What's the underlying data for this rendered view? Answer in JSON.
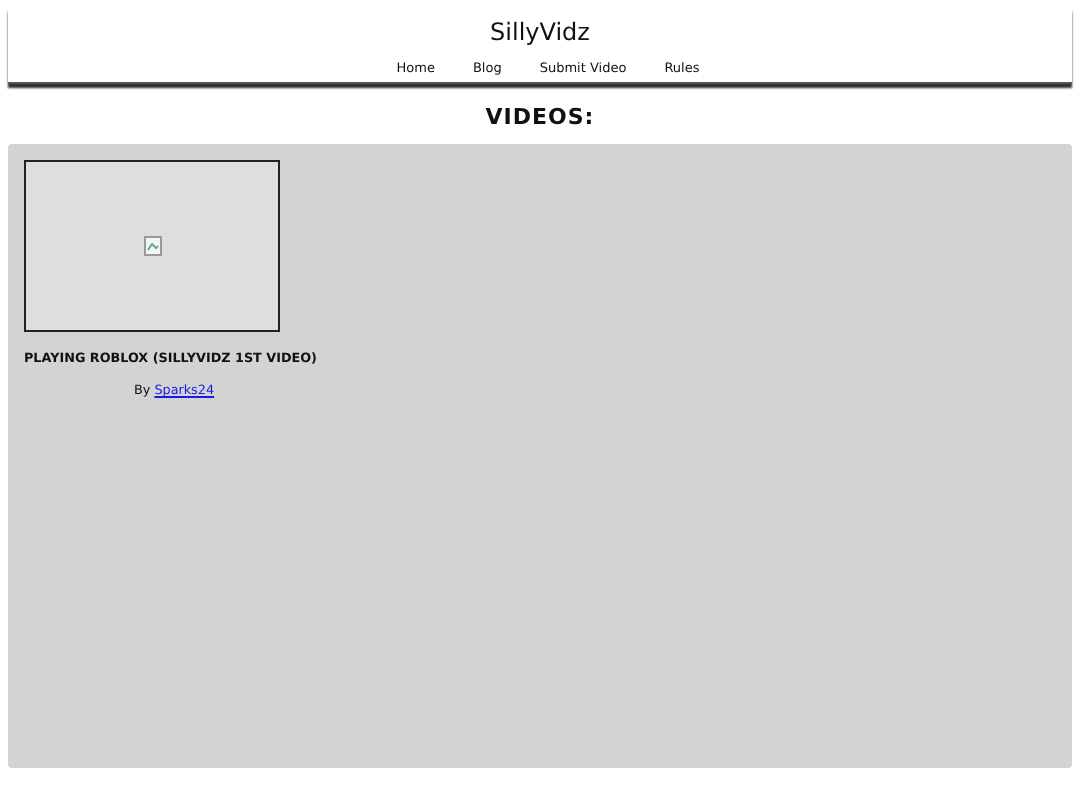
{
  "site_title": "SillyVidz",
  "nav": [
    "Home",
    "Blog",
    "Submit Video",
    "Rules"
  ],
  "heading": "VIDEOS:",
  "videos": [
    {
      "title": "PLAYING ROBLOX (SILLYVIDZ 1ST VIDEO)",
      "by_label": "By",
      "author": "Sparks24"
    }
  ]
}
